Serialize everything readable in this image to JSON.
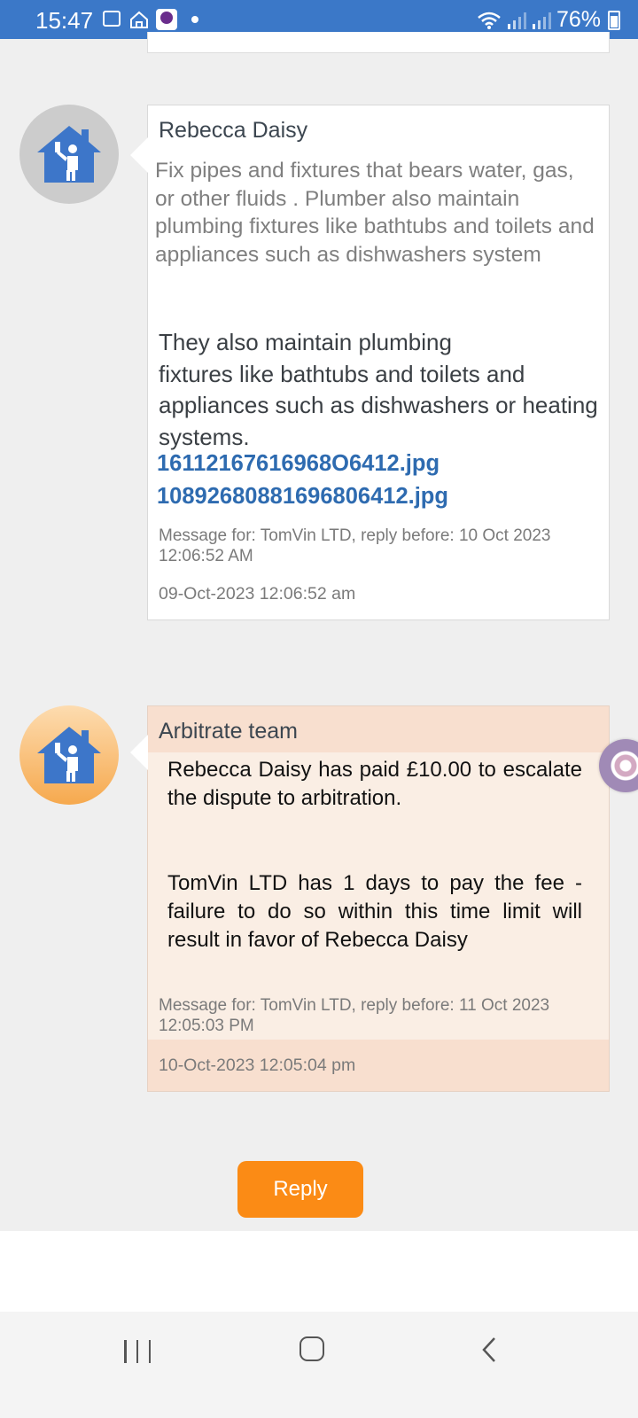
{
  "status_bar": {
    "time": "15:47",
    "battery": "76%",
    "icons": [
      "gallery-icon",
      "smart-home-icon",
      "app-notification-icon",
      "notification-dot-icon",
      "wifi-icon",
      "signal-icon",
      "signal-icon",
      "battery-icon"
    ]
  },
  "messages": [
    {
      "sender": "Rebecca Daisy",
      "avatar_icon": "plumber-house-icon",
      "body_gray": "Fix pipes and fixtures that bears water, gas, or other fluids . Plumber also maintain plumbing fixtures like bathtubs and toilets and appliances such as dishwashers system",
      "body_dark_line1": "They also maintain plumbing",
      "body_dark_line2": "fixtures like bathtubs and toilets and appliances such as dishwashers or heating systems.",
      "attachments": [
        "16112167616968O6412.jpg",
        "10892680881696806412.jpg"
      ],
      "meta": "Message for: TomVin LTD, reply before: 10 Oct 2023 12:06:52 AM",
      "timestamp": "09-Oct-2023 12:06:52 am"
    },
    {
      "sender": "Arbitrate team",
      "avatar_icon": "plumber-house-icon",
      "body_para1": "Rebecca Daisy has paid £10.00 to escalate the dispute to arbitration.",
      "body_para2": "TomVin LTD has 1 days to pay the fee - failure to do so within this time limit will result in favor of Rebecca Daisy",
      "meta": "Message for: TomVin LTD, reply before: 11 Oct 2023 12:05:03 PM",
      "timestamp": "10-Oct-2023 12:05:04 pm"
    }
  ],
  "reply_label": "Reply",
  "colors": {
    "status_bar": "#3b78c8",
    "accent_orange": "#fb8b15",
    "link_blue": "#2e6bb0",
    "icon_blue": "#3d76c9",
    "arb_bg": "#faeee4",
    "arb_header": "#f8dfcf"
  }
}
